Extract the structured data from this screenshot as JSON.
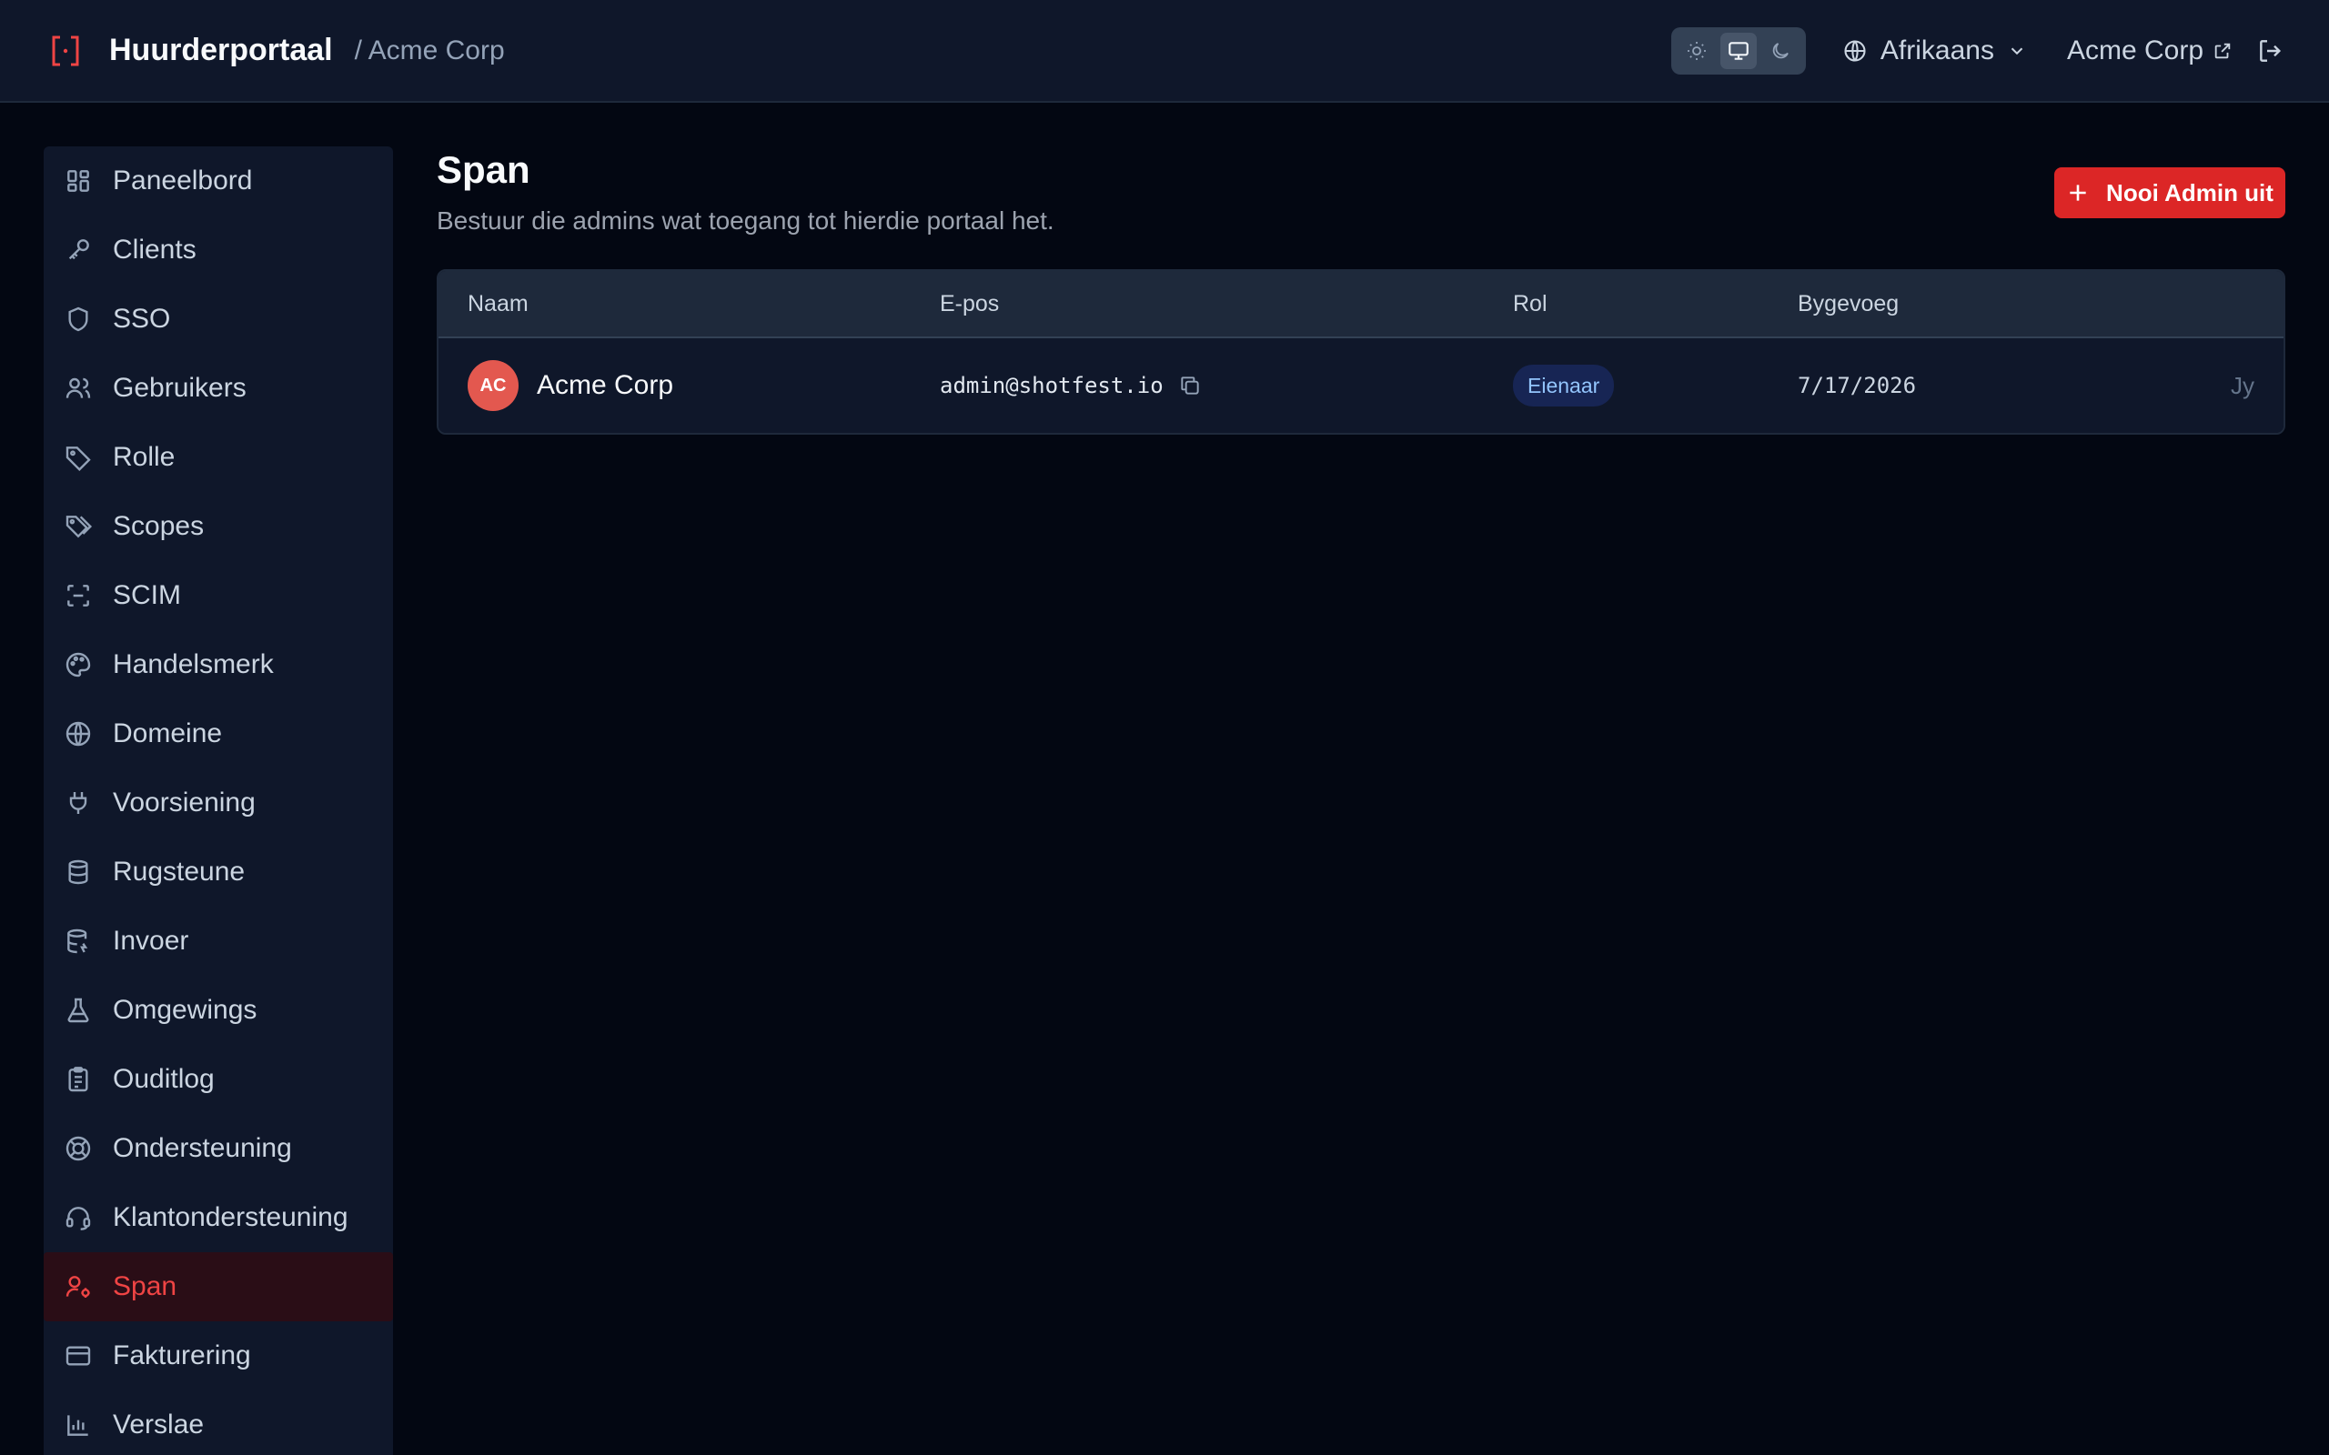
{
  "header": {
    "title": "Huurderportaal",
    "crumb": "/ Acme Corp",
    "language": "Afrikaans",
    "tenant_link": "Acme Corp",
    "accent": "#ef4444"
  },
  "sidebar": {
    "items": [
      {
        "label": "Paneelbord",
        "icon": "dashboard-icon"
      },
      {
        "label": "Clients",
        "icon": "key-icon"
      },
      {
        "label": "SSO",
        "icon": "shield-icon"
      },
      {
        "label": "Gebruikers",
        "icon": "users-icon"
      },
      {
        "label": "Rolle",
        "icon": "tag-icon"
      },
      {
        "label": "Scopes",
        "icon": "tags-icon"
      },
      {
        "label": "SCIM",
        "icon": "scan-icon"
      },
      {
        "label": "Handelsmerk",
        "icon": "palette-icon"
      },
      {
        "label": "Domeine",
        "icon": "globe-icon"
      },
      {
        "label": "Voorsiening",
        "icon": "plug-icon"
      },
      {
        "label": "Rugsteune",
        "icon": "database-icon"
      },
      {
        "label": "Invoer",
        "icon": "database-import-icon"
      },
      {
        "label": "Omgewings",
        "icon": "flask-icon"
      },
      {
        "label": "Ouditlog",
        "icon": "clipboard-icon"
      },
      {
        "label": "Ondersteuning",
        "icon": "lifebuoy-icon"
      },
      {
        "label": "Klantondersteuning",
        "icon": "headset-icon"
      },
      {
        "label": "Span",
        "icon": "user-cog-icon",
        "active": true
      },
      {
        "label": "Fakturering",
        "icon": "credit-card-icon"
      },
      {
        "label": "Verslae",
        "icon": "bar-chart-icon"
      }
    ]
  },
  "main": {
    "title": "Span",
    "subtitle": "Bestuur die admins wat toegang tot hierdie portaal het.",
    "invite_label": "Nooi Admin uit",
    "table": {
      "headers": [
        "Naam",
        "E-pos",
        "Rol",
        "Bygevoeg"
      ],
      "rows": [
        {
          "initials": "AC",
          "name": "Acme Corp",
          "email": "admin@shotfest.io",
          "role": "Eienaar",
          "added": "7/17/2026",
          "you": "Jy"
        }
      ]
    }
  }
}
